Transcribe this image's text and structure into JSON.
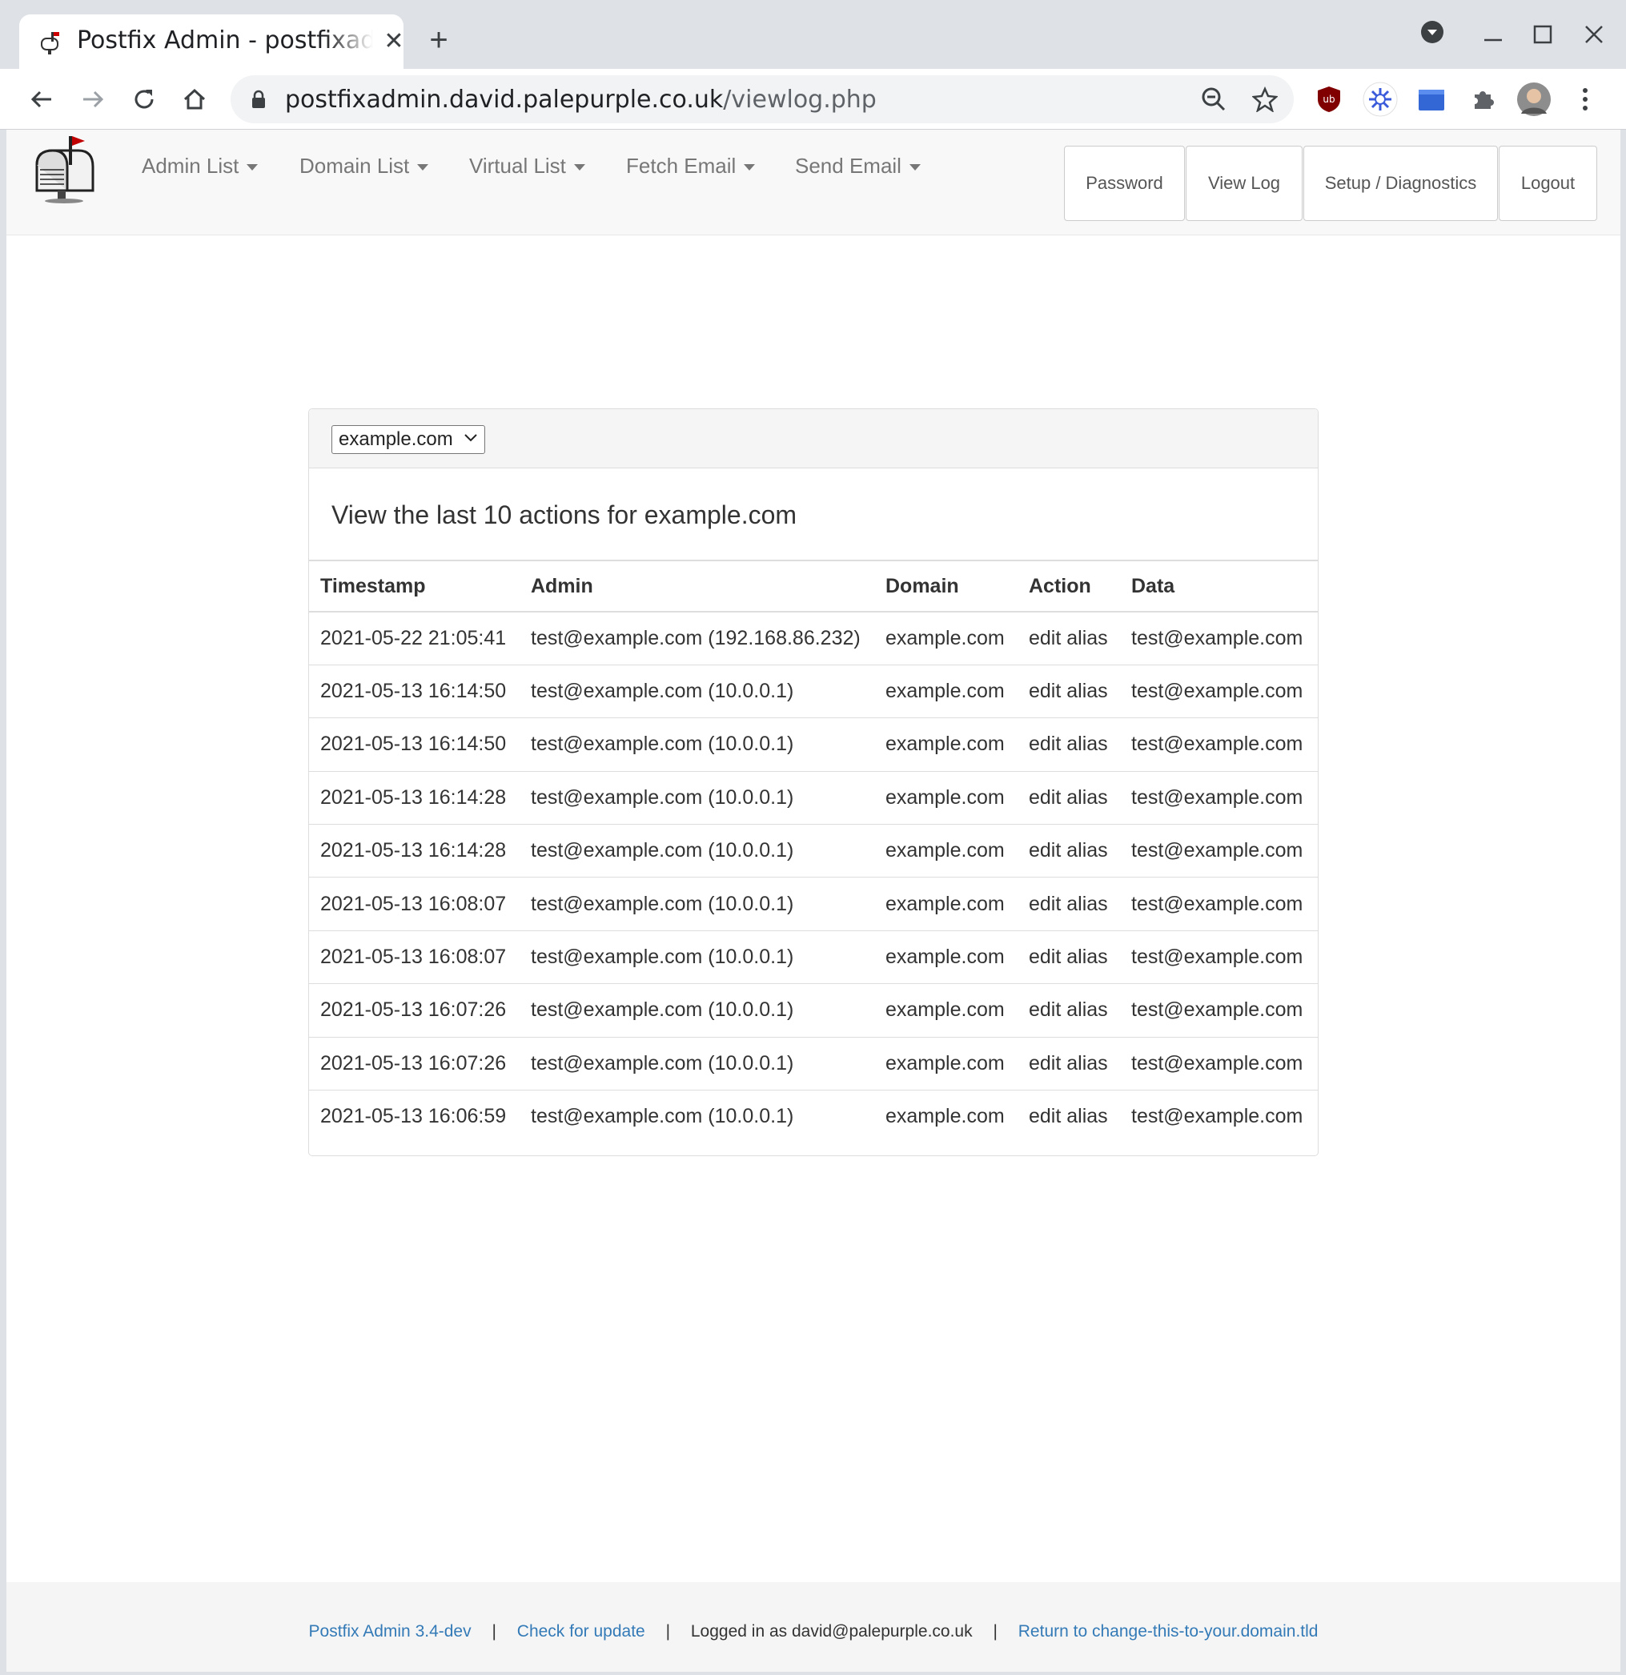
{
  "browser": {
    "tab_title": "Postfix Admin - postfixadmin.david.palepurple.co.uk",
    "new_tab_icon": "plus-icon",
    "url_host": "postfixadmin.david.palepurple.co.uk",
    "url_path": "/viewlog.php"
  },
  "nav": {
    "menus": [
      {
        "label": "Admin List"
      },
      {
        "label": "Domain List"
      },
      {
        "label": "Virtual List"
      },
      {
        "label": "Fetch Email"
      },
      {
        "label": "Send Email"
      }
    ],
    "buttons": [
      {
        "label": "Password"
      },
      {
        "label": "View Log"
      },
      {
        "label": "Setup / Diagnostics"
      },
      {
        "label": "Logout"
      }
    ]
  },
  "log": {
    "selected_domain": "example.com",
    "title": "View the last 10 actions for example.com",
    "columns": [
      "Timestamp",
      "Admin",
      "Domain",
      "Action",
      "Data"
    ],
    "rows": [
      [
        "2021-05-22 21:05:41",
        "test@example.com (192.168.86.232)",
        "example.com",
        "edit alias",
        "test@example.com"
      ],
      [
        "2021-05-13 16:14:50",
        "test@example.com (10.0.0.1)",
        "example.com",
        "edit alias",
        "test@example.com"
      ],
      [
        "2021-05-13 16:14:50",
        "test@example.com (10.0.0.1)",
        "example.com",
        "edit alias",
        "test@example.com"
      ],
      [
        "2021-05-13 16:14:28",
        "test@example.com (10.0.0.1)",
        "example.com",
        "edit alias",
        "test@example.com"
      ],
      [
        "2021-05-13 16:14:28",
        "test@example.com (10.0.0.1)",
        "example.com",
        "edit alias",
        "test@example.com"
      ],
      [
        "2021-05-13 16:08:07",
        "test@example.com (10.0.0.1)",
        "example.com",
        "edit alias",
        "test@example.com"
      ],
      [
        "2021-05-13 16:08:07",
        "test@example.com (10.0.0.1)",
        "example.com",
        "edit alias",
        "test@example.com"
      ],
      [
        "2021-05-13 16:07:26",
        "test@example.com (10.0.0.1)",
        "example.com",
        "edit alias",
        "test@example.com"
      ],
      [
        "2021-05-13 16:07:26",
        "test@example.com (10.0.0.1)",
        "example.com",
        "edit alias",
        "test@example.com"
      ],
      [
        "2021-05-13 16:06:59",
        "test@example.com (10.0.0.1)",
        "example.com",
        "edit alias",
        "test@example.com"
      ]
    ]
  },
  "footer": {
    "version": "Postfix Admin 3.4-dev",
    "check_update": "Check for update",
    "logged_in": "Logged in as david@palepurple.co.uk",
    "return_link": "Return to change-this-to-your.domain.tld",
    "separator": "|"
  },
  "colors": {
    "link": "#337ab7",
    "navbar_bg": "#f8f8f8",
    "chrome_bg": "#dee1e6"
  }
}
